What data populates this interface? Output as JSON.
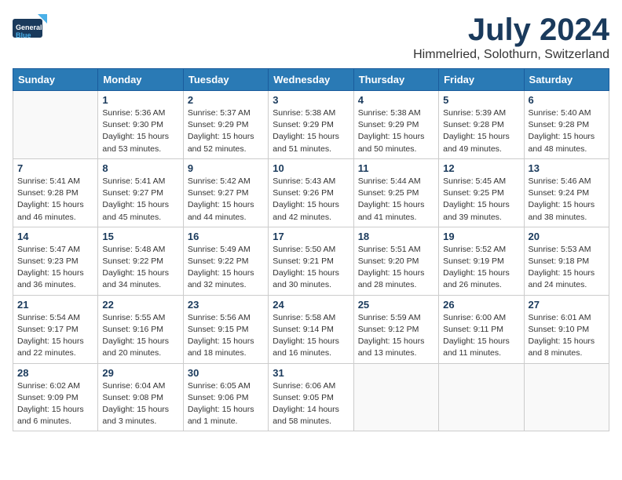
{
  "header": {
    "logo": {
      "line1": "General",
      "line2": "Blue"
    },
    "title": "July 2024",
    "subtitle": "Himmelried, Solothurn, Switzerland"
  },
  "calendar": {
    "weekdays": [
      "Sunday",
      "Monday",
      "Tuesday",
      "Wednesday",
      "Thursday",
      "Friday",
      "Saturday"
    ],
    "weeks": [
      [
        {
          "day": "",
          "info": ""
        },
        {
          "day": "1",
          "info": "Sunrise: 5:36 AM\nSunset: 9:30 PM\nDaylight: 15 hours\nand 53 minutes."
        },
        {
          "day": "2",
          "info": "Sunrise: 5:37 AM\nSunset: 9:29 PM\nDaylight: 15 hours\nand 52 minutes."
        },
        {
          "day": "3",
          "info": "Sunrise: 5:38 AM\nSunset: 9:29 PM\nDaylight: 15 hours\nand 51 minutes."
        },
        {
          "day": "4",
          "info": "Sunrise: 5:38 AM\nSunset: 9:29 PM\nDaylight: 15 hours\nand 50 minutes."
        },
        {
          "day": "5",
          "info": "Sunrise: 5:39 AM\nSunset: 9:28 PM\nDaylight: 15 hours\nand 49 minutes."
        },
        {
          "day": "6",
          "info": "Sunrise: 5:40 AM\nSunset: 9:28 PM\nDaylight: 15 hours\nand 48 minutes."
        }
      ],
      [
        {
          "day": "7",
          "info": "Sunrise: 5:41 AM\nSunset: 9:28 PM\nDaylight: 15 hours\nand 46 minutes."
        },
        {
          "day": "8",
          "info": "Sunrise: 5:41 AM\nSunset: 9:27 PM\nDaylight: 15 hours\nand 45 minutes."
        },
        {
          "day": "9",
          "info": "Sunrise: 5:42 AM\nSunset: 9:27 PM\nDaylight: 15 hours\nand 44 minutes."
        },
        {
          "day": "10",
          "info": "Sunrise: 5:43 AM\nSunset: 9:26 PM\nDaylight: 15 hours\nand 42 minutes."
        },
        {
          "day": "11",
          "info": "Sunrise: 5:44 AM\nSunset: 9:25 PM\nDaylight: 15 hours\nand 41 minutes."
        },
        {
          "day": "12",
          "info": "Sunrise: 5:45 AM\nSunset: 9:25 PM\nDaylight: 15 hours\nand 39 minutes."
        },
        {
          "day": "13",
          "info": "Sunrise: 5:46 AM\nSunset: 9:24 PM\nDaylight: 15 hours\nand 38 minutes."
        }
      ],
      [
        {
          "day": "14",
          "info": "Sunrise: 5:47 AM\nSunset: 9:23 PM\nDaylight: 15 hours\nand 36 minutes."
        },
        {
          "day": "15",
          "info": "Sunrise: 5:48 AM\nSunset: 9:22 PM\nDaylight: 15 hours\nand 34 minutes."
        },
        {
          "day": "16",
          "info": "Sunrise: 5:49 AM\nSunset: 9:22 PM\nDaylight: 15 hours\nand 32 minutes."
        },
        {
          "day": "17",
          "info": "Sunrise: 5:50 AM\nSunset: 9:21 PM\nDaylight: 15 hours\nand 30 minutes."
        },
        {
          "day": "18",
          "info": "Sunrise: 5:51 AM\nSunset: 9:20 PM\nDaylight: 15 hours\nand 28 minutes."
        },
        {
          "day": "19",
          "info": "Sunrise: 5:52 AM\nSunset: 9:19 PM\nDaylight: 15 hours\nand 26 minutes."
        },
        {
          "day": "20",
          "info": "Sunrise: 5:53 AM\nSunset: 9:18 PM\nDaylight: 15 hours\nand 24 minutes."
        }
      ],
      [
        {
          "day": "21",
          "info": "Sunrise: 5:54 AM\nSunset: 9:17 PM\nDaylight: 15 hours\nand 22 minutes."
        },
        {
          "day": "22",
          "info": "Sunrise: 5:55 AM\nSunset: 9:16 PM\nDaylight: 15 hours\nand 20 minutes."
        },
        {
          "day": "23",
          "info": "Sunrise: 5:56 AM\nSunset: 9:15 PM\nDaylight: 15 hours\nand 18 minutes."
        },
        {
          "day": "24",
          "info": "Sunrise: 5:58 AM\nSunset: 9:14 PM\nDaylight: 15 hours\nand 16 minutes."
        },
        {
          "day": "25",
          "info": "Sunrise: 5:59 AM\nSunset: 9:12 PM\nDaylight: 15 hours\nand 13 minutes."
        },
        {
          "day": "26",
          "info": "Sunrise: 6:00 AM\nSunset: 9:11 PM\nDaylight: 15 hours\nand 11 minutes."
        },
        {
          "day": "27",
          "info": "Sunrise: 6:01 AM\nSunset: 9:10 PM\nDaylight: 15 hours\nand 8 minutes."
        }
      ],
      [
        {
          "day": "28",
          "info": "Sunrise: 6:02 AM\nSunset: 9:09 PM\nDaylight: 15 hours\nand 6 minutes."
        },
        {
          "day": "29",
          "info": "Sunrise: 6:04 AM\nSunset: 9:08 PM\nDaylight: 15 hours\nand 3 minutes."
        },
        {
          "day": "30",
          "info": "Sunrise: 6:05 AM\nSunset: 9:06 PM\nDaylight: 15 hours\nand 1 minute."
        },
        {
          "day": "31",
          "info": "Sunrise: 6:06 AM\nSunset: 9:05 PM\nDaylight: 14 hours\nand 58 minutes."
        },
        {
          "day": "",
          "info": ""
        },
        {
          "day": "",
          "info": ""
        },
        {
          "day": "",
          "info": ""
        }
      ]
    ]
  }
}
